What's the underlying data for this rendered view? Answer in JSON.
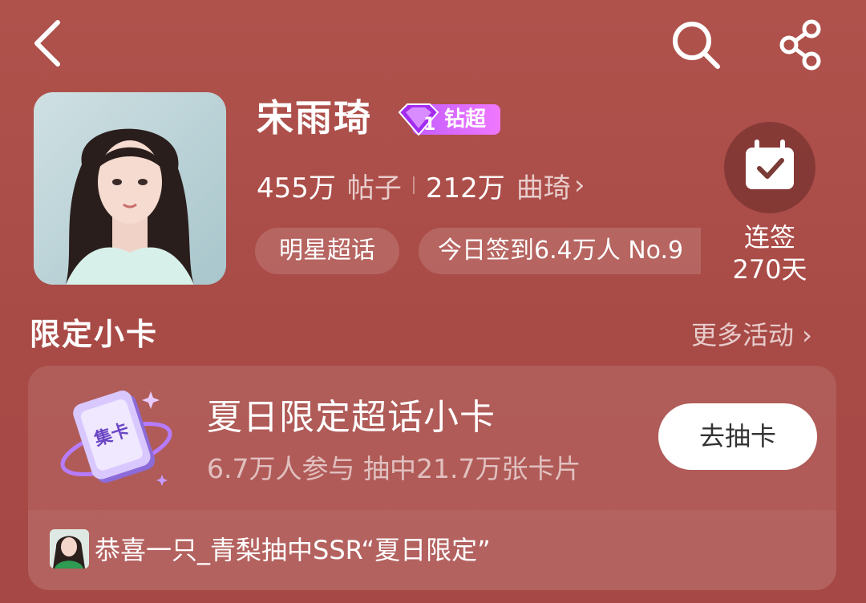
{
  "header": {
    "back_icon": "chevron-left-icon",
    "search_icon": "search-icon",
    "share_icon": "share-icon"
  },
  "profile": {
    "name": "宋雨琦",
    "badge_level": "1",
    "badge_label": "钻超",
    "posts_count": "455万",
    "posts_label": "帖子",
    "fans_count": "212万",
    "fans_label": "曲琦",
    "chevron": "›",
    "tags": [
      "明星超话",
      "今日签到6.4万人 No.9"
    ]
  },
  "checkin": {
    "icon": "calendar-check-icon",
    "line1": "连签",
    "line2": "270天"
  },
  "section": {
    "title": "限定小卡",
    "more_label": "更多活动 ›"
  },
  "card": {
    "icon_text": "集卡",
    "title": "夏日限定超话小卡",
    "subtitle": "6.7万人参与 抽中21.7万张卡片",
    "button_label": "去抽卡",
    "ticker": "恭喜一只_青梨抽中SSR“夏日限定”"
  },
  "colors": {
    "background": "#a84a46",
    "badge_gradient_start": "#c35cff",
    "badge_gradient_end": "#f078ff",
    "button_bg": "#ffffff"
  }
}
